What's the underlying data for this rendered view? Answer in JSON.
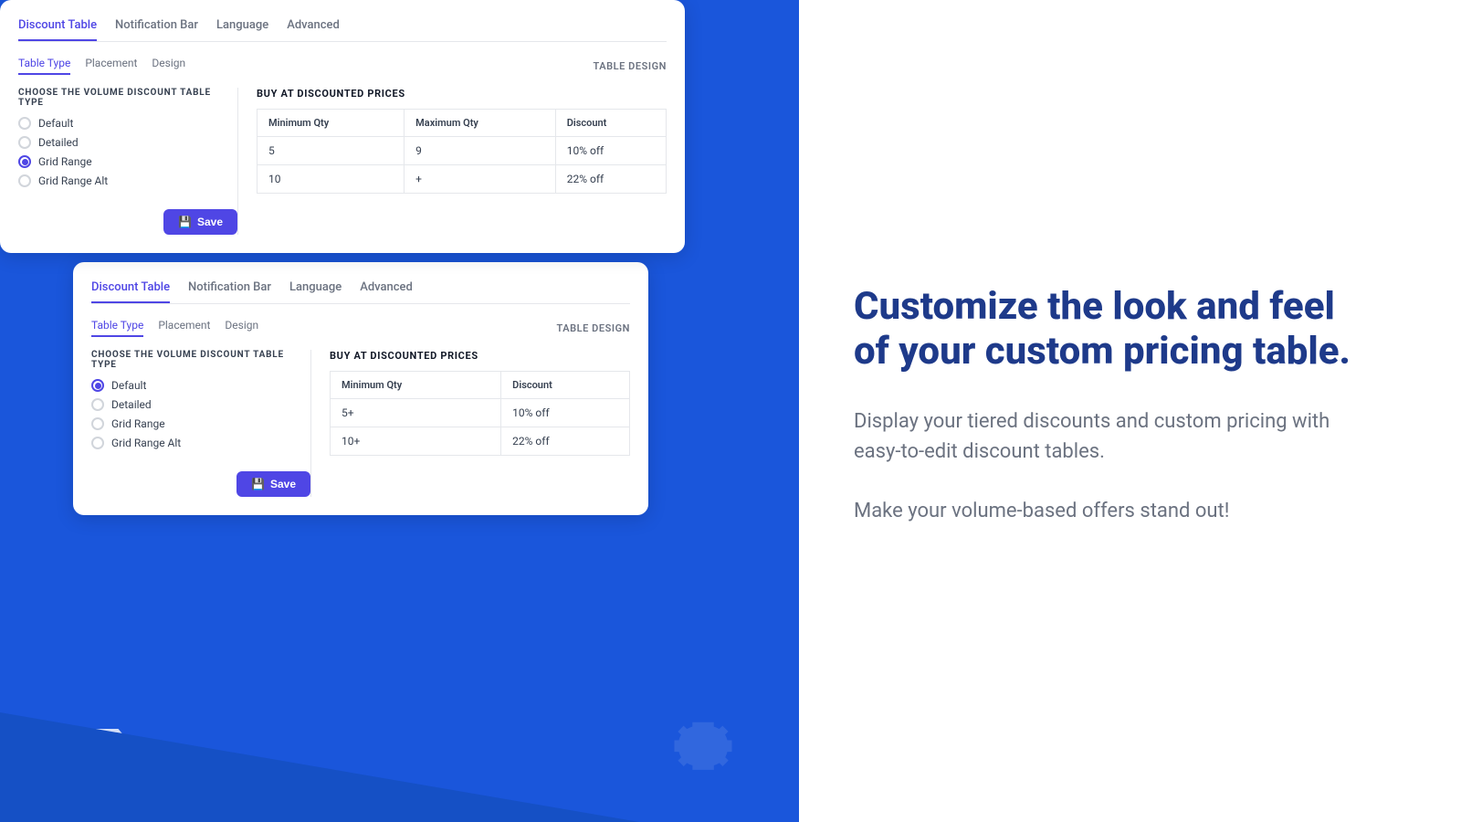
{
  "left": {
    "card_front": {
      "tabs": [
        {
          "label": "Discount Table",
          "active": true
        },
        {
          "label": "Notification Bar",
          "active": false
        },
        {
          "label": "Language",
          "active": false
        },
        {
          "label": "Advanced",
          "active": false
        }
      ],
      "sub_tabs": [
        {
          "label": "Table Type",
          "active": true
        },
        {
          "label": "Placement",
          "active": false
        },
        {
          "label": "Design",
          "active": false
        }
      ],
      "table_design_label": "TABLE DESIGN",
      "section_heading": "CHOOSE THE VOLUME DISCOUNT TABLE TYPE",
      "radio_options": [
        {
          "label": "Default",
          "selected": false
        },
        {
          "label": "Detailed",
          "selected": false
        },
        {
          "label": "Grid Range",
          "selected": true
        },
        {
          "label": "Grid Range Alt",
          "selected": false
        }
      ],
      "save_label": "Save",
      "table": {
        "title": "BUY AT DISCOUNTED PRICES",
        "headers": [
          "Minimum Qty",
          "Maximum Qty",
          "Discount"
        ],
        "rows": [
          {
            "col1": "5",
            "col2": "9",
            "col3": "10% off"
          },
          {
            "col1": "10",
            "col2": "+",
            "col3": "22% off"
          }
        ]
      }
    },
    "card_back": {
      "tabs": [
        {
          "label": "Discount Table",
          "active": true
        },
        {
          "label": "Notification Bar",
          "active": false
        },
        {
          "label": "Language",
          "active": false
        },
        {
          "label": "Advanced",
          "active": false
        }
      ],
      "sub_tabs": [
        {
          "label": "Table Type",
          "active": true
        },
        {
          "label": "Placement",
          "active": false
        },
        {
          "label": "Design",
          "active": false
        }
      ],
      "table_design_label": "TABLE DESIGN",
      "section_heading": "CHOOSE THE VOLUME DISCOUNT TABLE TYPE",
      "radio_options": [
        {
          "label": "Default",
          "selected": true
        },
        {
          "label": "Detailed",
          "selected": false
        },
        {
          "label": "Grid Range",
          "selected": false
        },
        {
          "label": "Grid Range Alt",
          "selected": false
        }
      ],
      "save_label": "Save",
      "table": {
        "title": "BUY AT DISCOUNTED PRICES",
        "headers": [
          "Minimum Qty",
          "Discount"
        ],
        "rows": [
          {
            "col1": "5+",
            "col2": "10% off"
          },
          {
            "col1": "10+",
            "col2": "22% off"
          }
        ]
      }
    }
  },
  "right": {
    "headline": "Customize the look and feel of your custom pricing table.",
    "body1": "Display your tiered discounts and custom pricing with easy-to-edit discount tables.",
    "body2": "Make your volume-based offers stand out!"
  }
}
